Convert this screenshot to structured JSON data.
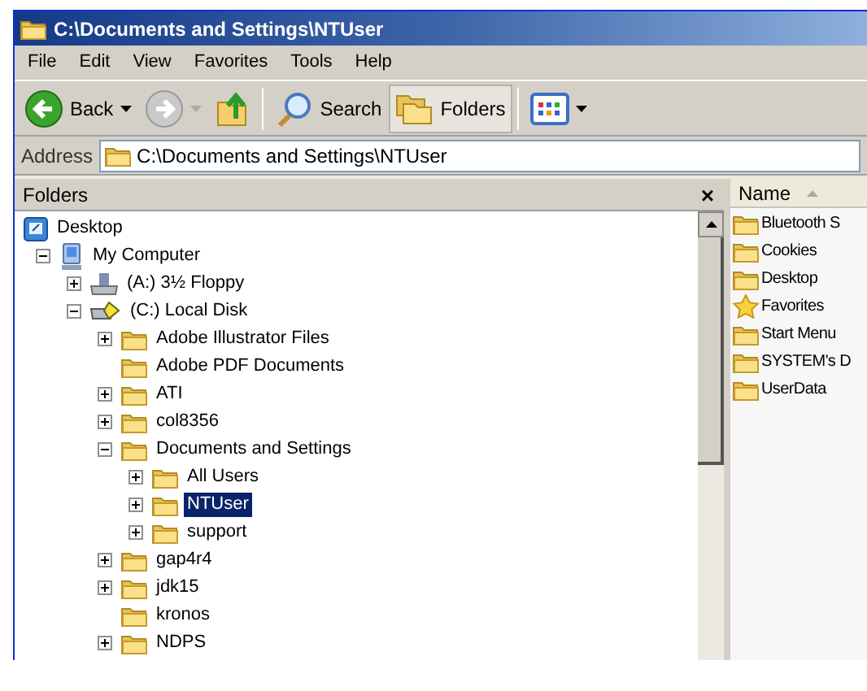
{
  "window": {
    "title": "C:\\Documents and Settings\\NTUser"
  },
  "menu": [
    "File",
    "Edit",
    "View",
    "Favorites",
    "Tools",
    "Help"
  ],
  "toolbar": [
    {
      "kind": "back",
      "label": "Back",
      "selected": false
    },
    {
      "kind": "forward",
      "selected": false
    },
    {
      "kind": "up",
      "selected": false
    },
    {
      "kind": "search",
      "label": "Search",
      "selected": false
    },
    {
      "kind": "folders",
      "label": "Folders",
      "selected": true
    },
    {
      "kind": "views",
      "selected": false
    }
  ],
  "address": {
    "label": "Address",
    "value": "C:\\Documents and Settings\\NTUser"
  },
  "folders_pane": {
    "title": "Folders",
    "close": "×",
    "tree": [
      {
        "kind": "desktop",
        "label": "Desktop",
        "selected": false,
        "children": [
          {
            "kind": "computer",
            "label": "My Computer",
            "expandable": true,
            "expanded": true,
            "selected": false,
            "children": [
              {
                "kind": "floppy",
                "label": "(A:) 3½ Floppy",
                "expandable": true,
                "expanded": false,
                "selected": false
              },
              {
                "kind": "disk",
                "label": "(C:) Local Disk",
                "expandable": true,
                "expanded": true,
                "selected": false,
                "children": [
                  {
                    "kind": "folder",
                    "label": "Adobe Illustrator Files",
                    "expandable": true,
                    "expanded": false,
                    "selected": false
                  },
                  {
                    "kind": "folder",
                    "label": "Adobe PDF Documents",
                    "expandable": false,
                    "selected": false
                  },
                  {
                    "kind": "folder",
                    "label": "ATI",
                    "expandable": true,
                    "expanded": false,
                    "selected": false
                  },
                  {
                    "kind": "folder",
                    "label": "col8356",
                    "expandable": true,
                    "expanded": false,
                    "selected": false
                  },
                  {
                    "kind": "folder",
                    "label": "Documents and Settings",
                    "expandable": true,
                    "expanded": true,
                    "selected": false,
                    "children": [
                      {
                        "kind": "folder",
                        "label": "All Users",
                        "expandable": true,
                        "expanded": false,
                        "selected": false
                      },
                      {
                        "kind": "folder",
                        "label": "NTUser",
                        "expandable": true,
                        "expanded": false,
                        "selected": true
                      },
                      {
                        "kind": "folder",
                        "label": "support",
                        "expandable": true,
                        "expanded": false,
                        "selected": false
                      }
                    ]
                  },
                  {
                    "kind": "folder",
                    "label": "gap4r4",
                    "expandable": true,
                    "expanded": false,
                    "selected": false
                  },
                  {
                    "kind": "folder",
                    "label": "jdk15",
                    "expandable": true,
                    "expanded": false,
                    "selected": false
                  },
                  {
                    "kind": "folder",
                    "label": "kronos",
                    "expandable": false,
                    "selected": false
                  },
                  {
                    "kind": "folder",
                    "label": "NDPS",
                    "expandable": true,
                    "expanded": false,
                    "selected": false
                  }
                ]
              }
            ]
          }
        ]
      }
    ]
  },
  "file_list": {
    "column": "Name",
    "items": [
      {
        "kind": "folder",
        "label": "Bluetooth S"
      },
      {
        "kind": "folder",
        "label": "Cookies"
      },
      {
        "kind": "folder",
        "label": "Desktop"
      },
      {
        "kind": "favorites",
        "label": "Favorites"
      },
      {
        "kind": "folder",
        "label": "Start Menu"
      },
      {
        "kind": "folder",
        "label": "SYSTEM's D"
      },
      {
        "kind": "folder",
        "label": "UserData"
      }
    ]
  }
}
